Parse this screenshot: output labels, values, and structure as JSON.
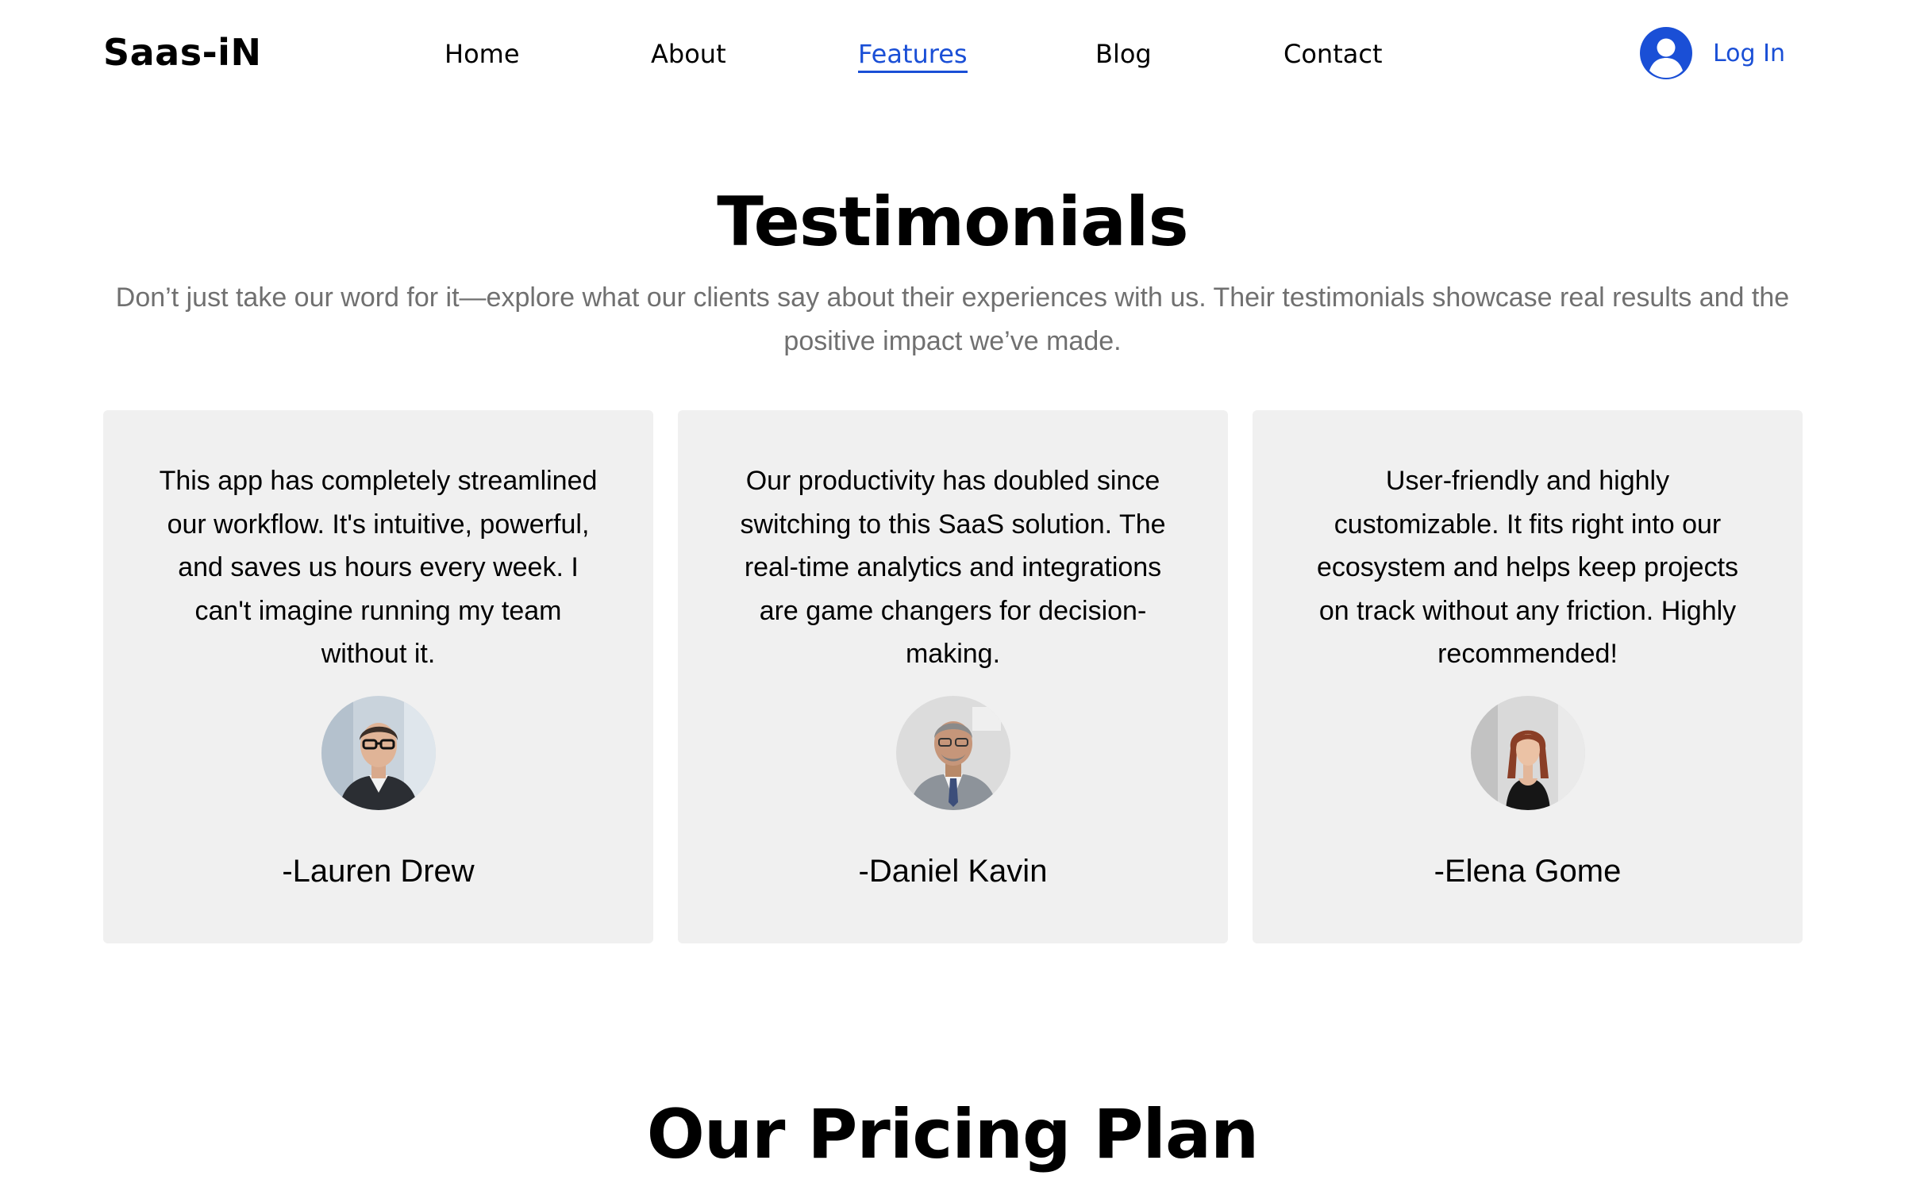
{
  "header": {
    "logo": "Saas-iN",
    "nav": [
      {
        "label": "Home"
      },
      {
        "label": "About"
      },
      {
        "label": "Features",
        "active": true
      },
      {
        "label": "Blog"
      },
      {
        "label": "Contact"
      }
    ],
    "login_label": "Log In",
    "login_icon": "user-avatar-icon",
    "accent_color": "#1a4fd6"
  },
  "testimonials": {
    "title": "Testimonials",
    "subtitle": "Don’t just take our word for it—explore what our clients say about their experiences with us. Their testimonials showcase real results and the positive impact we’ve made.",
    "cards": [
      {
        "quote": "This app has completely streamlined our workflow. It's intuitive, powerful, and saves us hours every week. I can't imagine running my team without it.",
        "author": "-Lauren Drew"
      },
      {
        "quote": "Our productivity has doubled since switching to this SaaS solution. The real-time analytics and integrations are game changers for decision-making.",
        "author": "-Daniel Kavin"
      },
      {
        "quote": "User-friendly and highly customizable. It fits right into our ecosystem and helps keep projects on track without any friction. Highly recommended!",
        "author": "-Elena Gome"
      }
    ]
  },
  "pricing": {
    "title": "Our Pricing Plan"
  }
}
